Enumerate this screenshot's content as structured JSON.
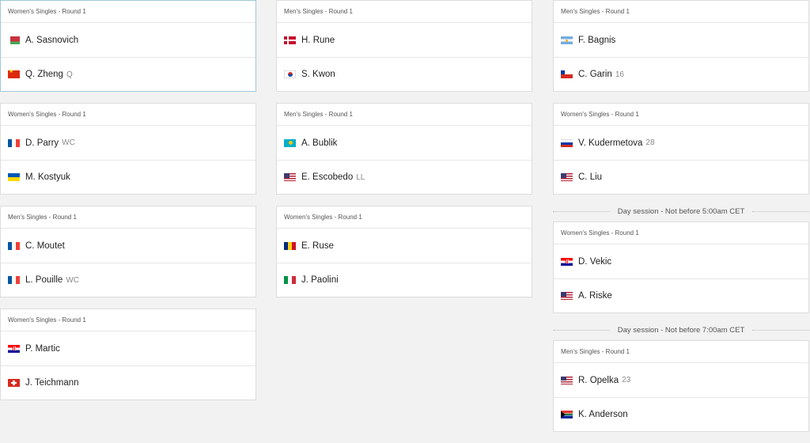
{
  "columns": [
    {
      "items": [
        {
          "type": "match",
          "header": "Women's Singles - Round 1",
          "selected": true,
          "players": [
            {
              "flag": "by",
              "name": "A. Sasnovich",
              "seed": ""
            },
            {
              "flag": "cn",
              "name": "Q. Zheng",
              "seed": "Q"
            }
          ]
        },
        {
          "type": "match",
          "header": "Women's Singles - Round 1",
          "players": [
            {
              "flag": "fr",
              "name": "D. Parry",
              "seed": "WC"
            },
            {
              "flag": "ua",
              "name": "M. Kostyuk",
              "seed": ""
            }
          ]
        },
        {
          "type": "match",
          "header": "Men's Singles - Round 1",
          "players": [
            {
              "flag": "fr",
              "name": "C. Moutet",
              "seed": ""
            },
            {
              "flag": "fr",
              "name": "L. Pouille",
              "seed": "WC"
            }
          ]
        },
        {
          "type": "match",
          "header": "Women's Singles - Round 1",
          "players": [
            {
              "flag": "hr",
              "name": "P. Martic",
              "seed": ""
            },
            {
              "flag": "ch",
              "name": "J. Teichmann",
              "seed": ""
            }
          ]
        }
      ]
    },
    {
      "items": [
        {
          "type": "match",
          "header": "Men's Singles - Round 1",
          "players": [
            {
              "flag": "dk",
              "name": "H. Rune",
              "seed": ""
            },
            {
              "flag": "kr",
              "name": "S. Kwon",
              "seed": ""
            }
          ]
        },
        {
          "type": "match",
          "header": "Men's Singles - Round 1",
          "players": [
            {
              "flag": "kz",
              "name": "A. Bublik",
              "seed": ""
            },
            {
              "flag": "us",
              "name": "E. Escobedo",
              "seed": "LL"
            }
          ]
        },
        {
          "type": "match",
          "header": "Women's Singles - Round 1",
          "players": [
            {
              "flag": "ro",
              "name": "E. Ruse",
              "seed": ""
            },
            {
              "flag": "it",
              "name": "J. Paolini",
              "seed": ""
            }
          ]
        }
      ]
    },
    {
      "items": [
        {
          "type": "match",
          "header": "Men's Singles - Round 1",
          "players": [
            {
              "flag": "ar",
              "name": "F. Bagnis",
              "seed": ""
            },
            {
              "flag": "cl",
              "name": "C. Garin",
              "seed": "16"
            }
          ]
        },
        {
          "type": "match",
          "header": "Women's Singles - Round 1",
          "players": [
            {
              "flag": "ru",
              "name": "V. Kudermetova",
              "seed": "28"
            },
            {
              "flag": "us",
              "name": "C. Liu",
              "seed": ""
            }
          ]
        },
        {
          "type": "session",
          "label": "Day session - Not before 5:00am CET"
        },
        {
          "type": "match",
          "header": "Women's Singles - Round 1",
          "players": [
            {
              "flag": "hr",
              "name": "D. Vekic",
              "seed": ""
            },
            {
              "flag": "us",
              "name": "A. Riske",
              "seed": ""
            }
          ]
        },
        {
          "type": "session",
          "label": "Day session - Not before 7:00am CET"
        },
        {
          "type": "match",
          "header": "Men's Singles - Round 1",
          "players": [
            {
              "flag": "us",
              "name": "R. Opelka",
              "seed": "23"
            },
            {
              "flag": "za",
              "name": "K. Anderson",
              "seed": ""
            }
          ]
        }
      ]
    }
  ]
}
